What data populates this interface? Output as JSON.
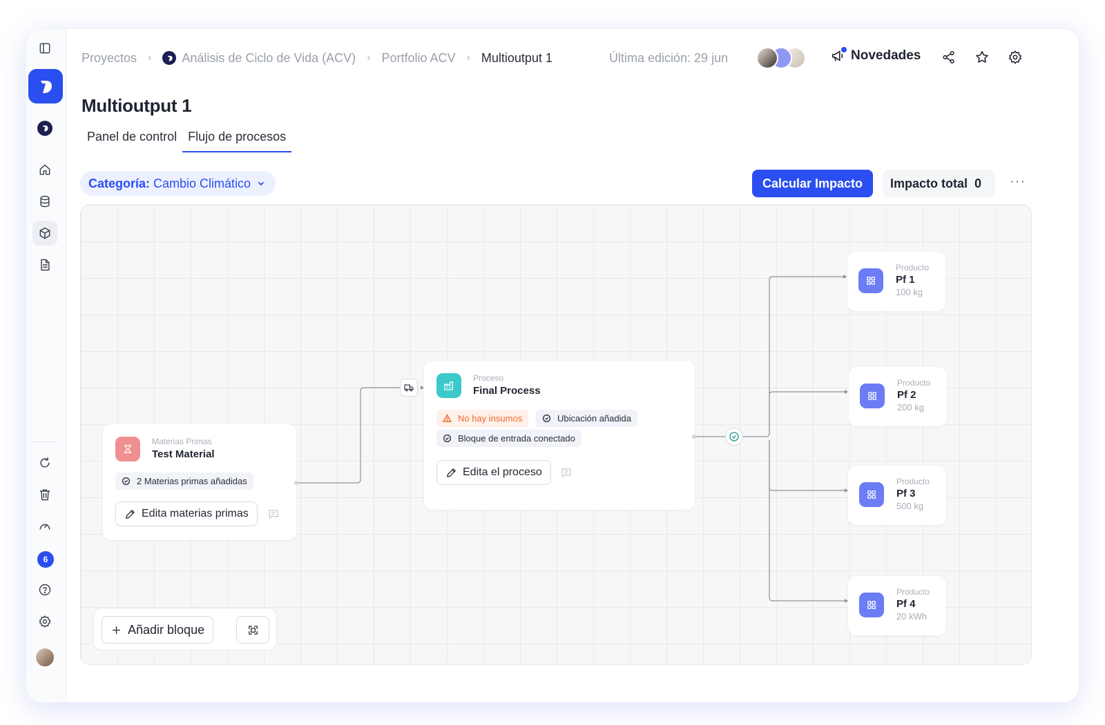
{
  "breadcrumb": {
    "items": [
      "Proyectos",
      "Análisis de Ciclo de Vida (ACV)",
      "Portfolio ACV",
      "Multioutput 1"
    ]
  },
  "header": {
    "last_edit": "Última edición: 29 jun",
    "news_label": "Novedades"
  },
  "page": {
    "title": "Multioutput 1",
    "tabs": [
      "Panel de control",
      "Flujo de procesos"
    ],
    "active_tab": "Flujo de procesos"
  },
  "toolbar": {
    "category_label": "Categoría:",
    "category_value": "Cambio Climático",
    "calc_button": "Calcular Impacto",
    "total_label": "Impacto total",
    "total_value": "0",
    "more": "···"
  },
  "sidebar": {
    "badge_count": "6"
  },
  "canvas": {
    "raw_material": {
      "kind": "Materias Primas",
      "name": "Test Material",
      "status": "2 Materias primas añadidas",
      "edit_button": "Edita materias primas"
    },
    "process": {
      "kind": "Proceso",
      "name": "Final Process",
      "warning": "No hay insumos",
      "status_location": "Ubicación añadida",
      "status_input": "Bloque de entrada conectado",
      "edit_button": "Edita el proceso"
    },
    "products": [
      {
        "kind": "Producto",
        "name": "Pf 1",
        "amount": "100 kg"
      },
      {
        "kind": "Producto",
        "name": "Pf 2",
        "amount": "200 kg"
      },
      {
        "kind": "Producto",
        "name": "Pf 3",
        "amount": "500 kg"
      },
      {
        "kind": "Producto",
        "name": "Pf 4",
        "amount": "20 kWh"
      }
    ],
    "add_block_button": "Añadir bloque"
  },
  "colors": {
    "accent": "#2a4ef0",
    "raw_material_chip": "#f08f8f",
    "process_chip": "#3cc9c9",
    "product_chip": "#6b7cf5",
    "warning": "#ef6a2c"
  }
}
